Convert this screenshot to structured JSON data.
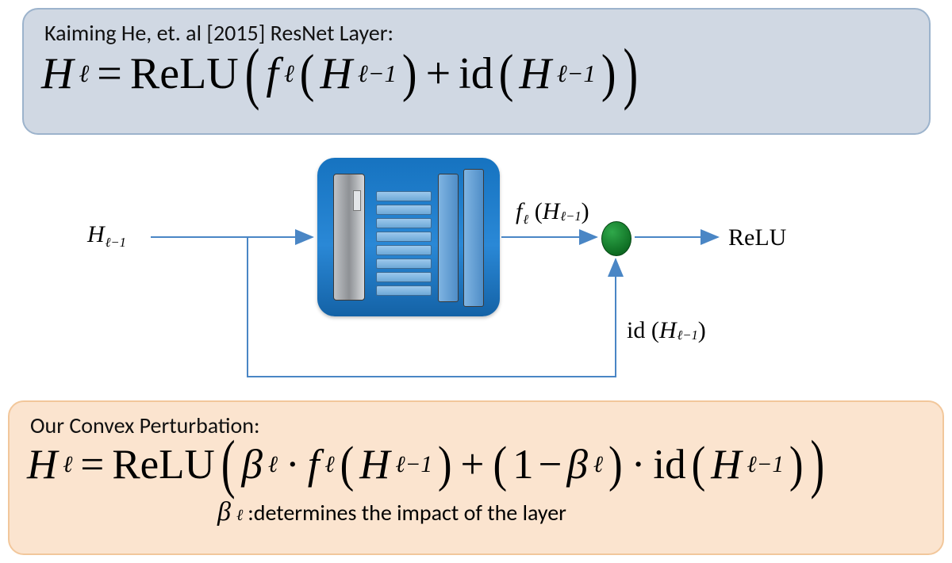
{
  "top_panel": {
    "title": "Kaiming He, et. al [2015] ResNet Layer:",
    "formula": {
      "H": "H",
      "ell": "ℓ",
      "eq": "=",
      "ReLU": "ReLU",
      "f": "f",
      "H2": "H",
      "ellm1": "ℓ−1",
      "plus": "+",
      "id": "id",
      "H3": "H",
      "ellm1b": "ℓ−1"
    }
  },
  "diagram": {
    "input_label_H": "H",
    "input_label_sub": "ℓ−1",
    "f_label_f": "f",
    "f_label_ell": "ℓ",
    "f_label_H": "H",
    "f_label_sub": "ℓ−1",
    "id_label_id": "id",
    "id_label_H": "H",
    "id_label_sub": "ℓ−1",
    "relu": "ReLU"
  },
  "bottom_panel": {
    "title": "Our Convex Perturbation:",
    "formula": {
      "H": "H",
      "ell": "ℓ",
      "eq": "=",
      "ReLU": "ReLU",
      "beta1": "β",
      "ell_b1": "ℓ",
      "dot1": "·",
      "f": "f",
      "ell_f": "ℓ",
      "H2": "H",
      "ellm1": "ℓ−1",
      "plus": "+",
      "one": "1",
      "minus": "−",
      "beta2": "β",
      "ell_b2": "ℓ",
      "dot2": "·",
      "id": "id",
      "H3": "H",
      "ellm1b": "ℓ−1"
    },
    "footnote_sym": "β",
    "footnote_sub": "ℓ",
    "footnote_text": ":determines the impact of the layer"
  }
}
